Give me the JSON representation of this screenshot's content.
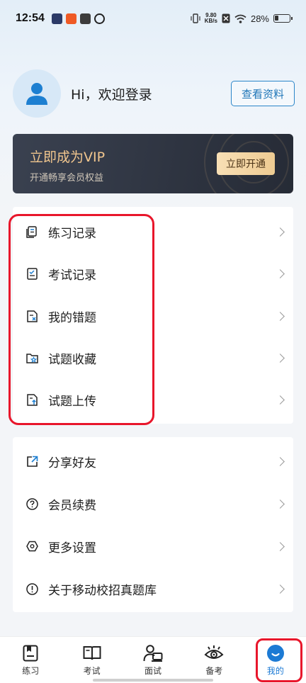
{
  "status_bar": {
    "time": "12:54",
    "net_speed_value": "9.80",
    "net_speed_unit": "KB/s",
    "battery": "28%"
  },
  "profile": {
    "greeting": "Hi，欢迎登录",
    "view_profile_label": "查看资料"
  },
  "vip": {
    "title": "立即成为VIP",
    "subtitle": "开通畅享会员权益",
    "button_label": "立即开通"
  },
  "menu_group_1": [
    {
      "label": "练习记录",
      "icon": "document-list-icon"
    },
    {
      "label": "考试记录",
      "icon": "exam-checklist-icon"
    },
    {
      "label": "我的错题",
      "icon": "wrong-questions-icon"
    },
    {
      "label": "试题收藏",
      "icon": "folder-star-icon"
    },
    {
      "label": "试题上传",
      "icon": "file-upload-icon"
    }
  ],
  "menu_group_2": [
    {
      "label": "分享好友",
      "icon": "share-icon"
    },
    {
      "label": "会员续费",
      "icon": "help-circle-icon"
    },
    {
      "label": "更多设置",
      "icon": "settings-hexagon-icon"
    },
    {
      "label": "关于移动校招真题库",
      "icon": "info-circle-icon"
    }
  ],
  "tabs": [
    {
      "label": "练习",
      "icon": "practice-icon",
      "active": false
    },
    {
      "label": "考试",
      "icon": "exam-book-icon",
      "active": false
    },
    {
      "label": "面试",
      "icon": "interview-icon",
      "active": false
    },
    {
      "label": "备考",
      "icon": "eye-prep-icon",
      "active": false
    },
    {
      "label": "我的",
      "icon": "profile-face-icon",
      "active": true
    }
  ],
  "colors": {
    "accent": "#1c7ad4",
    "highlight": "#e8162b",
    "vip_gold": "#f1c68e"
  }
}
